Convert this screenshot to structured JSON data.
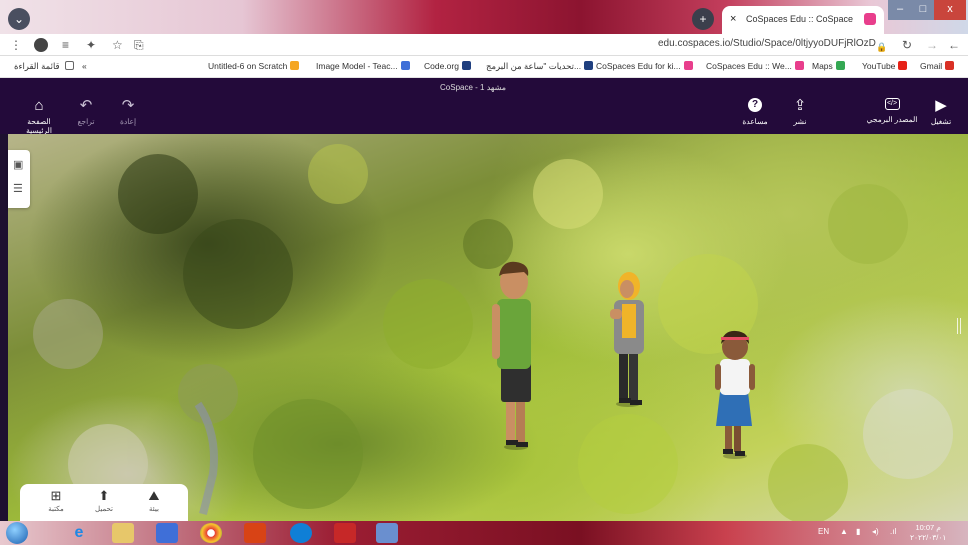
{
  "browser": {
    "tab_title": "CoSpaces Edu :: CoSpace",
    "tab_close": "×",
    "new_tab": "+",
    "url": "edu.cospaces.io/Studio/Space/0ltjyyoDUFjRlOzD",
    "menu_glyph": "⋮",
    "star_glyph": "☆",
    "reload_glyph": "↻",
    "back_glyph": "←",
    "forward_glyph": "→",
    "lock_glyph": "🔒",
    "win_min": "–",
    "win_max": "□",
    "win_close": "x"
  },
  "bookmarks": {
    "reading_list": "قائمة القراءة",
    "chevron": "«",
    "items": [
      {
        "label": "Untitled-6 on Scratch",
        "color": "#f5a623"
      },
      {
        "label": "Image Model - Teac...",
        "color": "#3f6fd8"
      },
      {
        "label": "Code.org",
        "color": "#1f3f7f"
      },
      {
        "label": "تحديات \"ساعة من البرمج...",
        "color": "#1f3f7f"
      },
      {
        "label": "CoSpaces Edu for ki...",
        "color": "#e83e8c"
      },
      {
        "label": "CoSpaces Edu :: We...",
        "color": "#e83e8c"
      },
      {
        "label": "Maps",
        "color": "#34a853"
      },
      {
        "label": "YouTube",
        "color": "#e62117"
      },
      {
        "label": "Gmail",
        "color": "#d93025"
      }
    ]
  },
  "app": {
    "space_title": "CoSpace - مشهد 1",
    "home_label": "الصفحة الرئيسية",
    "undo_label": "تراجع",
    "redo_label": "إعادة",
    "help_label": "مساعدة",
    "share_label": "نشر",
    "code_label": "المصدر البرمجي",
    "play_label": "تشغيل",
    "home_glyph": "⌂",
    "undo_glyph": "↶",
    "redo_glyph": "↷",
    "help_glyph": "?",
    "share_glyph": "⇪",
    "code_glyph": "</>",
    "play_glyph": "▶"
  },
  "side_panel": {
    "gallery_glyph": "▣",
    "list_glyph": "☰"
  },
  "library": {
    "library_label": "مكتبة",
    "upload_label": "تحميل",
    "environment_label": "بيئة",
    "library_glyph": "⊞",
    "upload_glyph": "⬆",
    "environment_glyph": "⛰"
  },
  "taskbar": {
    "lang": "EN",
    "time": "10:07 م",
    "date": "٢٠٢٢/٠٣/٠١"
  },
  "colors": {
    "app_bar": "#230a3a",
    "accent": "#e83e8c"
  }
}
